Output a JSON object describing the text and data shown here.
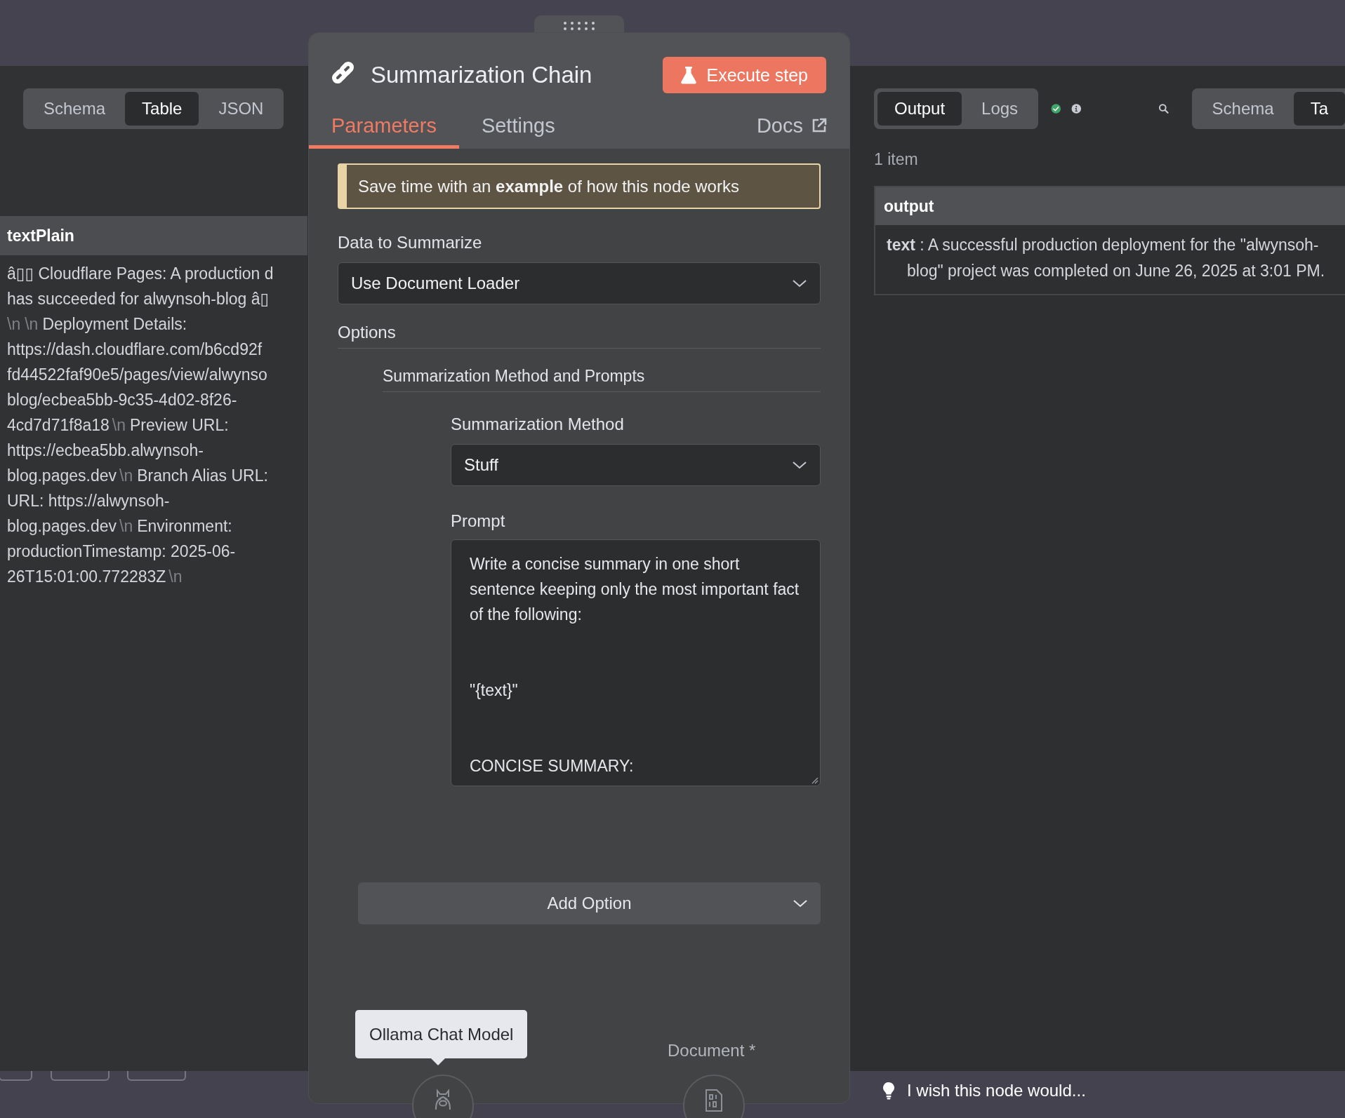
{
  "input_panel": {
    "view_tabs": [
      {
        "label": "Schema",
        "selected": false
      },
      {
        "label": "Table",
        "selected": true
      },
      {
        "label": "JSON",
        "selected": false
      }
    ],
    "table": {
      "column": "textPlain",
      "cell_lines": [
        [
          {
            "kind": "text",
            "text": "â▯▯ Cloudflare Pages: A production d"
          }
        ],
        [
          {
            "kind": "text",
            "text": "has succeeded for alwynsoh-blog â▯"
          }
        ],
        [
          {
            "kind": "escape",
            "text": "\\n"
          },
          {
            "kind": "escape",
            "text": "\\n"
          },
          {
            "kind": "text",
            "text": "Deployment Details:"
          }
        ],
        [
          {
            "kind": "text",
            "text": "https://dash.cloudflare.com/b6cd92f"
          }
        ],
        [
          {
            "kind": "text",
            "text": "fd44522faf90e5/pages/view/alwynso"
          }
        ],
        [
          {
            "kind": "text",
            "text": "blog/ecbea5bb-9c35-4d02-8f26-"
          }
        ],
        [
          {
            "kind": "text",
            "text": "4cd7d71f8a18"
          },
          {
            "kind": "escape",
            "text": "\\n"
          },
          {
            "kind": "text",
            "text": "Preview URL:"
          }
        ],
        [
          {
            "kind": "text",
            "text": "https://ecbea5bb.alwynsoh-"
          }
        ],
        [
          {
            "kind": "text",
            "text": "blog.pages.dev"
          },
          {
            "kind": "escape",
            "text": "\\n"
          },
          {
            "kind": "text",
            "text": "Branch Alias URL:"
          }
        ],
        [
          {
            "kind": "text",
            "text": "URL: https://alwynsoh-"
          }
        ],
        [
          {
            "kind": "text",
            "text": "blog.pages.dev"
          },
          {
            "kind": "escape",
            "text": "\\n"
          },
          {
            "kind": "text",
            "text": "Environment:"
          }
        ],
        [
          {
            "kind": "text",
            "text": "productionTimestamp: 2025-06-"
          }
        ],
        [
          {
            "kind": "text",
            "text": "26T15:01:00.772283Z"
          },
          {
            "kind": "escape",
            "text": "\\n"
          }
        ]
      ]
    }
  },
  "node": {
    "title": "Summarization Chain",
    "execute_button": "Execute step",
    "tabs": [
      {
        "label": "Parameters",
        "selected": true
      },
      {
        "label": "Settings",
        "selected": false
      }
    ],
    "docs_link": "Docs",
    "notice": "Save time with an **example** of how this node works",
    "data_to_summarize": {
      "label": "Data to Summarize",
      "value": "Use Document Loader"
    },
    "options_heading": "Options",
    "group_heading": "Summarization Method and Prompts",
    "summarization_method": {
      "label": "Summarization Method",
      "value": "Stuff"
    },
    "prompt": {
      "label": "Prompt",
      "value": "Write a concise summary in one short sentence keeping only the most important fact of the following:\n\n\n\"{text}\"\n\n\nCONCISE SUMMARY:"
    },
    "add_option": "Add Option",
    "inputs": {
      "tooltip": "Ollama Chat Model",
      "document_label": "Document *"
    }
  },
  "output_panel": {
    "tabs": [
      {
        "label": "Output",
        "selected": true
      },
      {
        "label": "Logs",
        "selected": false
      }
    ],
    "view_tabs": [
      {
        "label": "Schema",
        "selected": false
      },
      {
        "label": "Ta",
        "selected": true
      }
    ],
    "item_count": "1 item",
    "table": {
      "column": "output",
      "entry": "**text** : A successful production deployment for the \"alwynsoh-blog\" project was completed on June 26, 2025 at 3:01 PM."
    }
  },
  "feedback": "I wish this node would..."
}
